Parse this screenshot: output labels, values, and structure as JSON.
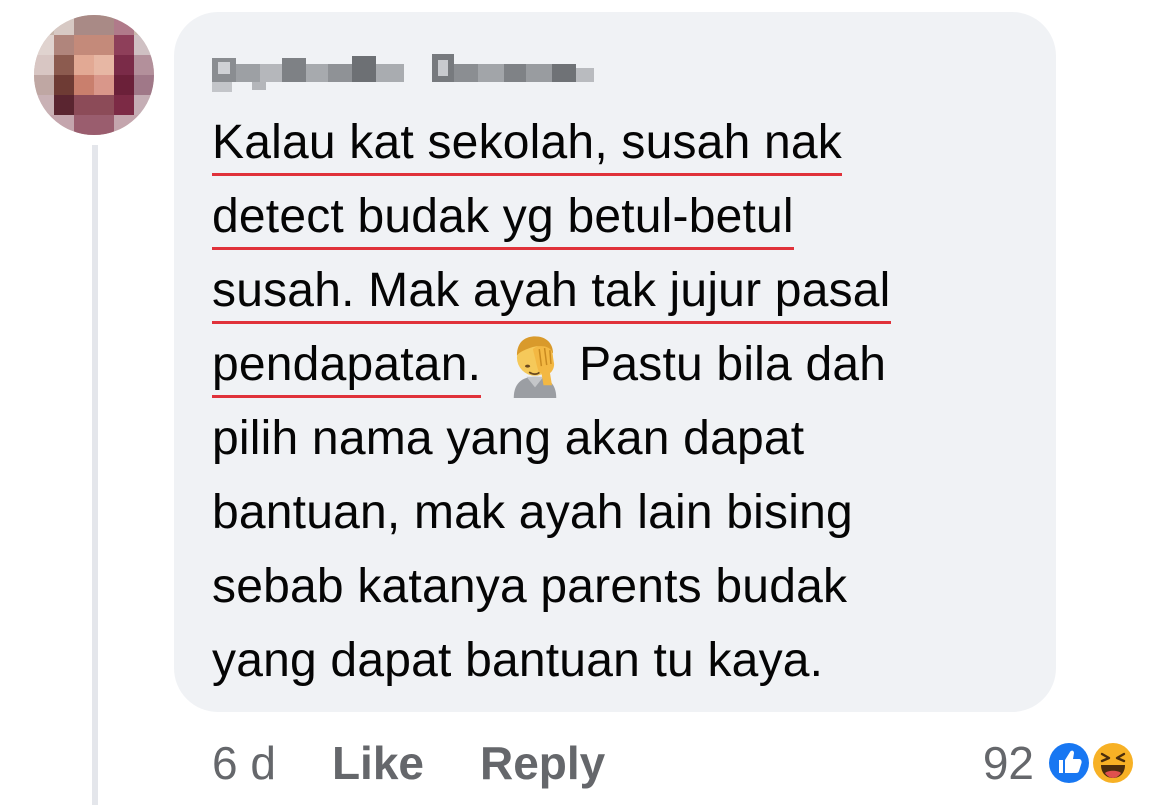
{
  "comment": {
    "lines": [
      {
        "text": "Kalau kat sekolah, susah nak",
        "underline": true
      },
      {
        "text": "detect budak yg betul-betul",
        "underline": true
      },
      {
        "text": "susah. Mak ayah tak jujur pasal",
        "underline": true
      },
      {
        "text": "pendapatan.",
        "underline": true,
        "trailing": "Pastu bila dah"
      },
      {
        "text": "pilih nama yang akan dapat"
      },
      {
        "text": "bantuan, mak ayah lain bising"
      },
      {
        "text": "sebab katanya parents budak"
      },
      {
        "text": "yang dapat bantuan tu kaya."
      }
    ],
    "emoji": "person-facepalming-emoji"
  },
  "footer": {
    "timestamp": "6 d",
    "like_label": "Like",
    "reply_label": "Reply"
  },
  "reactions": {
    "count": "92",
    "types": [
      "like-reaction-icon",
      "haha-reaction-icon"
    ]
  },
  "colors": {
    "bubble_bg": "#f0f2f5",
    "underline": "#e0323a",
    "meta_text": "#65676b",
    "like_blue": "#1877f2",
    "haha_yellow": "#f7b125"
  }
}
